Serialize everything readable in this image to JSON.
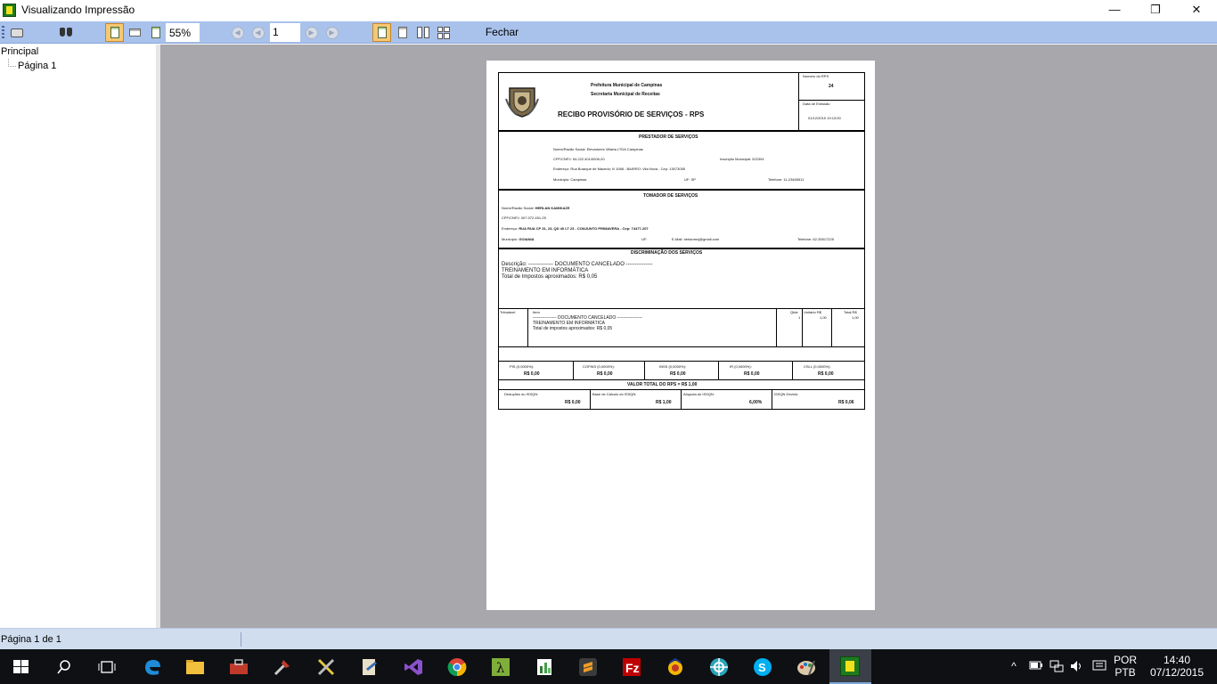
{
  "window": {
    "title": "Visualizando Impressão",
    "minimize": "—",
    "maximize": "❐",
    "close": "✕"
  },
  "toolbar": {
    "zoom": "55%",
    "page": "1",
    "close_label": "Fechar"
  },
  "tree": {
    "root": "Principal",
    "child": "Página 1"
  },
  "status": {
    "text": "Página 1 de 1"
  },
  "receipt": {
    "header": {
      "city": "Prefeitura Municipal de Campinas",
      "dept": "Secretaria Municipal de Receitas",
      "title": "RECIBO PROVISÓRIO DE SERVIÇOS - RPS",
      "rps_number_label": "Numero do RPS",
      "rps_number": "24",
      "issue_date_label": "Data de Emissão",
      "issue_date": "01/12/2015 19:13:00"
    },
    "provider": {
      "title": "PRESTADOR DE SERVIÇOS",
      "name_label": "Nome/Razão Social:",
      "name": "Elevadores Villarta LTDA Campinas",
      "cnpj_label": "CPF/CNPJ:",
      "cnpj": "54.222.401/0006-20",
      "im_label": "Inscrição Municipal:",
      "im": "522394",
      "address_label": "Endereço:",
      "address": "Rua Buarque de Macedo; N 1088 - BAIRRO: Vila Nova - Cep: 13073055",
      "city_label": "Município:",
      "city": "Campinas",
      "uf_label": "UF:",
      "uf": "SP",
      "phone_label": "Telefone:",
      "phone": "11-23465511"
    },
    "customer": {
      "title": "TOMADOR DE SERVIÇOS",
      "name_label": "Nome/Razão Social:",
      "name": "HERLAN KAMIKAZE",
      "cnpj_label": "CPF/CNPJ:",
      "cnpj": "007.072.451-25",
      "address_label": "Endereço:",
      "address": "RUA RUA CP 31, 23, QD 40 LT 23 - CONJUNTO PRIMAVERA - Cep: 74477-207",
      "city_label": "Município:",
      "city": "GOIANIA",
      "uf_label": "UF:",
      "uf": "",
      "email_label": "E-Mail:",
      "email": "herlanmxj@gmail.com",
      "phone_label": "Telefone:",
      "phone": "62-35517225"
    },
    "services": {
      "title": "DISCRIMINAÇÃO DOS SERVIÇOS",
      "line1": "Descrição: -------------- DOCUMENTO CANCELADO ---------------",
      "line2": "TREINAMENTO EM INFORMÁTICA",
      "line3": "Total de Impostos aproximados: R$ 0,05"
    },
    "items": {
      "col_trib": "Tributável",
      "col_item": "Item",
      "col_qty": "Qtde",
      "col_unit": "Unitário R$",
      "col_total": "Total R$",
      "row_line1": "---------------- DOCUMENTO CANCELADO -----------------",
      "row_line2": "TREINAMENTO EM INFORMÁTICA",
      "row_line3": "Total de impostos aproximados: R$ 0,05",
      "qty": "1",
      "unit": "1,00",
      "total": "1,00"
    },
    "taxes": [
      {
        "label": "PIS (0,0000%):",
        "value": "R$ 0,00"
      },
      {
        "label": "COFINS (0,0000%):",
        "value": "R$ 0,00"
      },
      {
        "label": "INSS (0,0000%):",
        "value": "R$ 0,00"
      },
      {
        "label": "IR (0,0000%):",
        "value": "R$ 0,00"
      },
      {
        "label": "CSLL (0,0000%):",
        "value": "R$ 0,00"
      }
    ],
    "total": "VALOR TOTAL DO RPS = R$    1,00",
    "issqn": [
      {
        "label": "Deduções do ISSQN:",
        "value": "R$ 0,00"
      },
      {
        "label": "Base de Cálculo do ISSQN:",
        "value": "R$ 1,00"
      },
      {
        "label": "Alíquota do ISSQN:",
        "value": "6,00%"
      },
      {
        "label": "ISSQN Devido:",
        "value": "R$ 0,06"
      }
    ]
  },
  "taskbar": {
    "lang1": "POR",
    "lang2": "PTB",
    "time": "14:40",
    "date": "07/12/2015"
  }
}
